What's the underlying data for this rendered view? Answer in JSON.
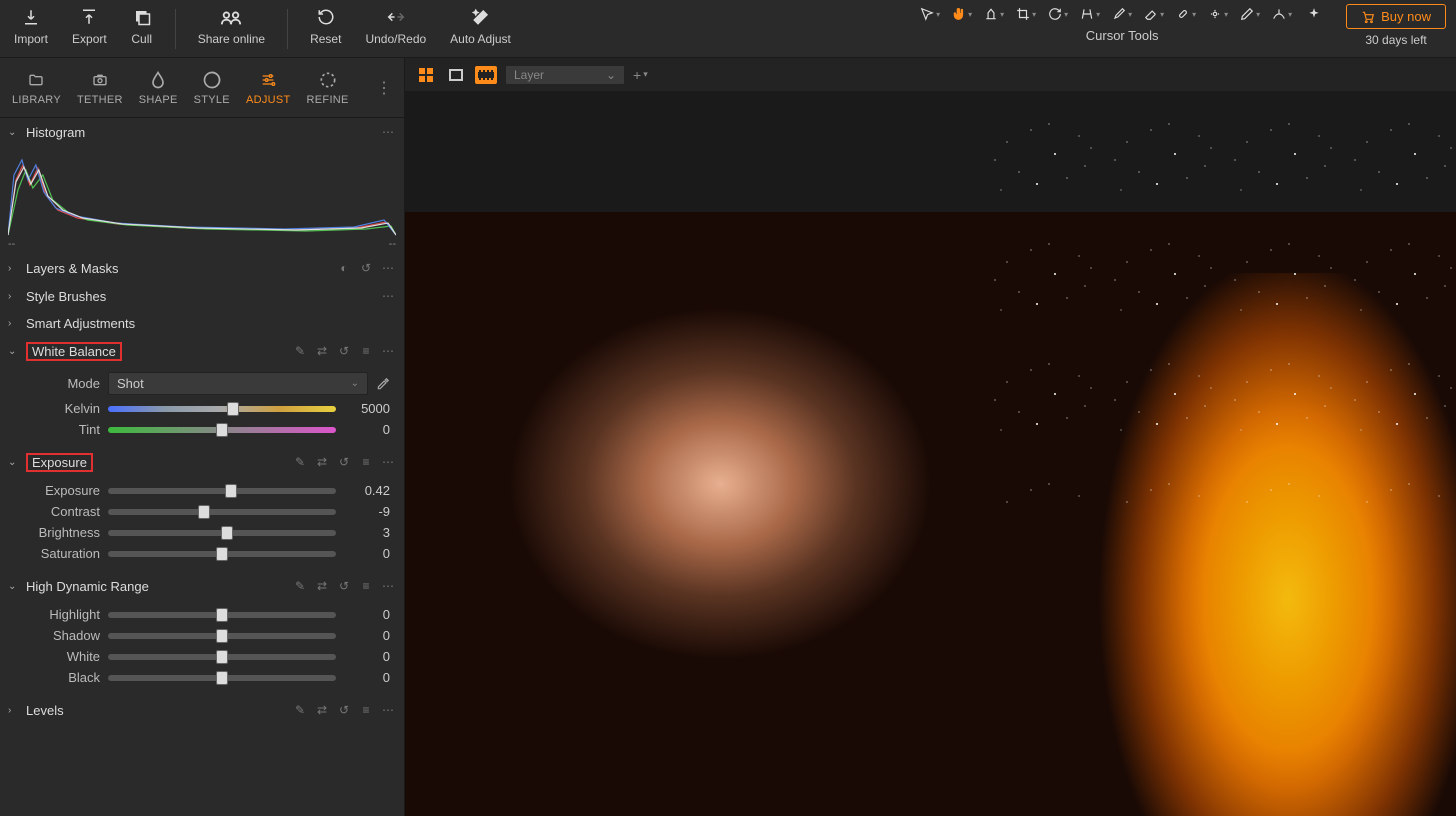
{
  "topbar": {
    "import": "Import",
    "export": "Export",
    "cull": "Cull",
    "share": "Share online",
    "reset": "Reset",
    "undoRedo": "Undo/Redo",
    "autoAdjust": "Auto Adjust",
    "cursorTools": "Cursor Tools",
    "buyNow": "Buy now",
    "trial": "30 days left"
  },
  "tabs": {
    "library": "LIBRARY",
    "tether": "TETHER",
    "shape": "SHAPE",
    "style": "STYLE",
    "adjust": "ADJUST",
    "refine": "REFINE"
  },
  "sections": {
    "histogram": "Histogram",
    "layersMasks": "Layers & Masks",
    "styleBrushes": "Style Brushes",
    "smartAdjustments": "Smart Adjustments",
    "whiteBalance": "White Balance",
    "exposure": "Exposure",
    "hdr": "High Dynamic Range",
    "levels": "Levels"
  },
  "histoFooter": {
    "left": "--",
    "right": "--"
  },
  "wb": {
    "modeLabel": "Mode",
    "modeValue": "Shot",
    "kelvinLabel": "Kelvin",
    "kelvinValue": "5000",
    "tintLabel": "Tint",
    "tintValue": "0"
  },
  "exp": {
    "exposureLabel": "Exposure",
    "exposureValue": "0.42",
    "contrastLabel": "Contrast",
    "contrastValue": "-9",
    "brightnessLabel": "Brightness",
    "brightnessValue": "3",
    "saturationLabel": "Saturation",
    "saturationValue": "0"
  },
  "hdr": {
    "highlightLabel": "Highlight",
    "highlightValue": "0",
    "shadowLabel": "Shadow",
    "shadowValue": "0",
    "whiteLabel": "White",
    "whiteValue": "0",
    "blackLabel": "Black",
    "blackValue": "0"
  },
  "canvas": {
    "layerPlaceholder": "Layer"
  }
}
